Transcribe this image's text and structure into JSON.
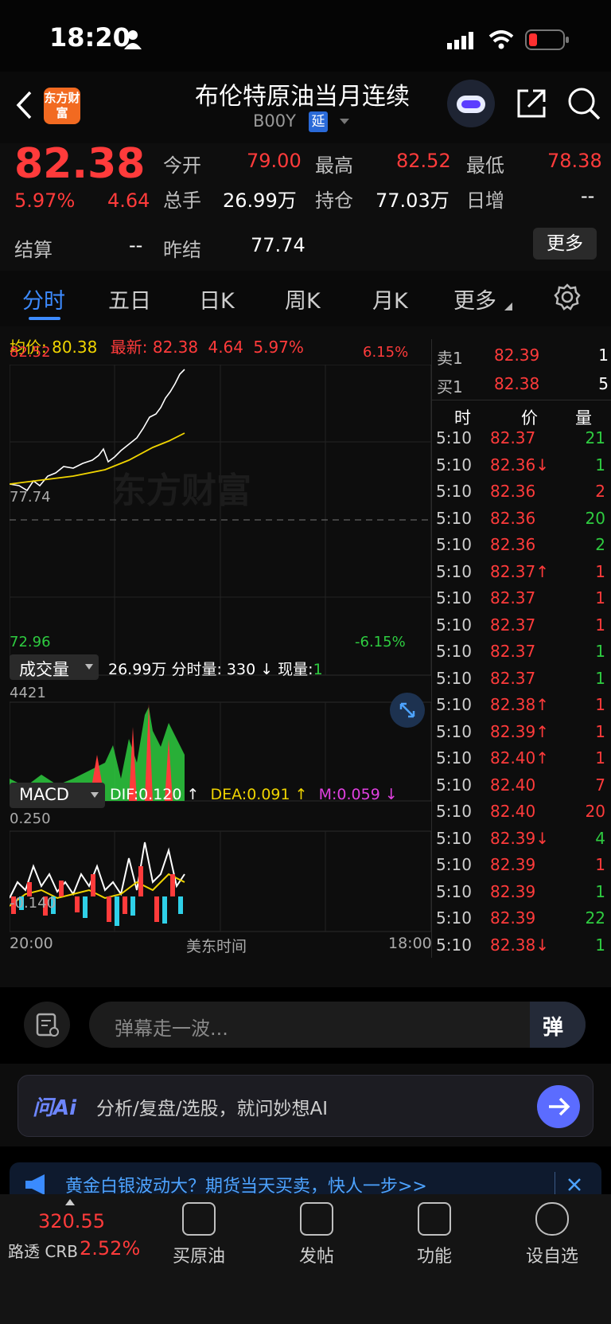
{
  "status_bar": {
    "time": "18:20"
  },
  "header": {
    "title": "布伦特原油当月连续",
    "code": "B00Y",
    "delay_badge": "延",
    "logo_text": "东方财富"
  },
  "quote": {
    "price": "82.38",
    "change_pct": "5.97%",
    "change": "4.64",
    "open_label": "今开",
    "open": "79.00",
    "high_label": "最高",
    "high": "82.52",
    "low_label": "最低",
    "low": "78.38",
    "volume_label": "总手",
    "volume": "26.99万",
    "oi_label": "持仓",
    "oi": "77.03万",
    "daily_inc_label": "日增",
    "daily_inc": "--",
    "settle_label": "结算",
    "settle": "--",
    "prev_settle_label": "昨结",
    "prev_settle": "77.74",
    "more_button": "更多"
  },
  "tabs": [
    "分时",
    "五日",
    "日K",
    "周K",
    "月K",
    "更多"
  ],
  "info_line": {
    "avg_label": "均价:",
    "avg": "80.38",
    "latest_label": "最新:",
    "latest": "82.38",
    "change": "4.64",
    "pct": "5.97%"
  },
  "price_chart": {
    "top_price": "82.52",
    "top_pct": "6.15%",
    "base_price": "77.74",
    "bottom_price": "72.96",
    "bottom_pct": "-6.15%",
    "watermark": "东方财富"
  },
  "volume_panel": {
    "label": "成交量",
    "total": "26.99万",
    "tick_vol": "分时量: 330 ↓",
    "cur_label": "现量:",
    "cur": "1",
    "max": "4421"
  },
  "macd_panel": {
    "label": "MACD",
    "dif": "DIF:0.120 ↑",
    "dea": "DEA:0.091 ↑",
    "m": "M:0.059 ↓",
    "top": "0.250",
    "bottom": "-0.140"
  },
  "time_axis": {
    "start": "20:00",
    "mid": "美东时间",
    "end": "18:00"
  },
  "order_book": {
    "sell_label": "卖1",
    "sell_price": "82.39",
    "sell_qty": "1",
    "buy_label": "买1",
    "buy_price": "82.38",
    "buy_qty": "5",
    "col_time": "时",
    "col_price": "价",
    "col_qty": "量"
  },
  "ticks": [
    {
      "t": "5:10",
      "p": "82.37",
      "q": "21",
      "qc": "green"
    },
    {
      "t": "5:10",
      "p": "82.36↓",
      "q": "1",
      "qc": "green"
    },
    {
      "t": "5:10",
      "p": "82.36",
      "q": "2",
      "qc": "red"
    },
    {
      "t": "5:10",
      "p": "82.36",
      "q": "20",
      "qc": "green"
    },
    {
      "t": "5:10",
      "p": "82.36",
      "q": "2",
      "qc": "green"
    },
    {
      "t": "5:10",
      "p": "82.37↑",
      "q": "1",
      "qc": "red"
    },
    {
      "t": "5:10",
      "p": "82.37",
      "q": "1",
      "qc": "red"
    },
    {
      "t": "5:10",
      "p": "82.37",
      "q": "1",
      "qc": "red"
    },
    {
      "t": "5:10",
      "p": "82.37",
      "q": "1",
      "qc": "green"
    },
    {
      "t": "5:10",
      "p": "82.37",
      "q": "1",
      "qc": "green"
    },
    {
      "t": "5:10",
      "p": "82.38↑",
      "q": "1",
      "qc": "red"
    },
    {
      "t": "5:10",
      "p": "82.39↑",
      "q": "1",
      "qc": "red"
    },
    {
      "t": "5:10",
      "p": "82.40↑",
      "q": "1",
      "qc": "red"
    },
    {
      "t": "5:10",
      "p": "82.40",
      "q": "7",
      "qc": "red"
    },
    {
      "t": "5:10",
      "p": "82.40",
      "q": "20",
      "qc": "red"
    },
    {
      "t": "5:10",
      "p": "82.39↓",
      "q": "4",
      "qc": "green"
    },
    {
      "t": "5:10",
      "p": "82.39",
      "q": "1",
      "qc": "red"
    },
    {
      "t": "5:10",
      "p": "82.39",
      "q": "1",
      "qc": "green"
    },
    {
      "t": "5:10",
      "p": "82.39",
      "q": "22",
      "qc": "green"
    },
    {
      "t": "5:10",
      "p": "82.38↓",
      "q": "1",
      "qc": "green"
    }
  ],
  "danmaku": {
    "placeholder": "弹幕走一波...",
    "button": "弹"
  },
  "ai_bar": {
    "badge": "问Ai",
    "text": "分析/复盘/选股，就问妙想AI"
  },
  "banner": {
    "text": "黄金白银波动大？期货当天买卖，快人一步>>"
  },
  "bottom_nav": {
    "index_value": "320.55",
    "index_name": "路透 CRB",
    "index_pct": "2.52%",
    "items": [
      "买原油",
      "发帖",
      "功能",
      "设自选"
    ]
  }
}
